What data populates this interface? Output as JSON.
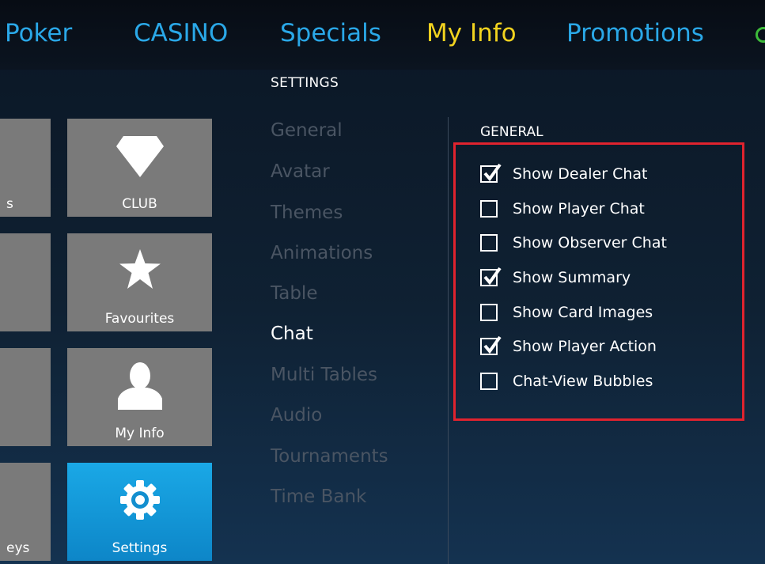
{
  "topnav": {
    "items": [
      {
        "label": "Poker",
        "active": false
      },
      {
        "label": "CASINO",
        "active": false
      },
      {
        "label": "Specials",
        "active": false
      },
      {
        "label": "My Info",
        "active": true
      },
      {
        "label": "Promotions",
        "active": false
      }
    ]
  },
  "tiles": [
    {
      "label": "CLUB",
      "cut_label": "s",
      "icon": "diamond-icon",
      "selected": false
    },
    {
      "label": "Favourites",
      "cut_label": "",
      "icon": "star-icon",
      "selected": false
    },
    {
      "label": "My Info",
      "cut_label": "",
      "icon": "person-icon",
      "selected": false
    },
    {
      "label": "Settings",
      "cut_label": "eys",
      "icon": "gear-icon",
      "selected": true
    }
  ],
  "settings": {
    "title": "SETTINGS",
    "menu": [
      {
        "label": "General",
        "active": false
      },
      {
        "label": "Avatar",
        "active": false
      },
      {
        "label": "Themes",
        "active": false
      },
      {
        "label": "Animations",
        "active": false
      },
      {
        "label": "Table",
        "active": false
      },
      {
        "label": "Chat",
        "active": true
      },
      {
        "label": "Multi Tables",
        "active": false
      },
      {
        "label": "Audio",
        "active": false
      },
      {
        "label": "Tournaments",
        "active": false
      },
      {
        "label": "Time Bank",
        "active": false
      }
    ]
  },
  "general": {
    "title": "GENERAL",
    "options": [
      {
        "label": "Show Dealer Chat",
        "checked": true
      },
      {
        "label": "Show Player Chat",
        "checked": false
      },
      {
        "label": "Show Observer Chat",
        "checked": false
      },
      {
        "label": "Show Summary",
        "checked": true
      },
      {
        "label": "Show Card Images",
        "checked": false
      },
      {
        "label": "Show Player Action",
        "checked": true
      },
      {
        "label": "Chat-View Bubbles",
        "checked": false
      }
    ]
  },
  "colors": {
    "nav_link": "#2aa8e8",
    "nav_active": "#f2d31f",
    "tile_gray": "#7a7a7a",
    "tile_selected": "#1aa8e6",
    "highlight_border": "#e0232e",
    "menu_inactive": "#4a5563"
  }
}
